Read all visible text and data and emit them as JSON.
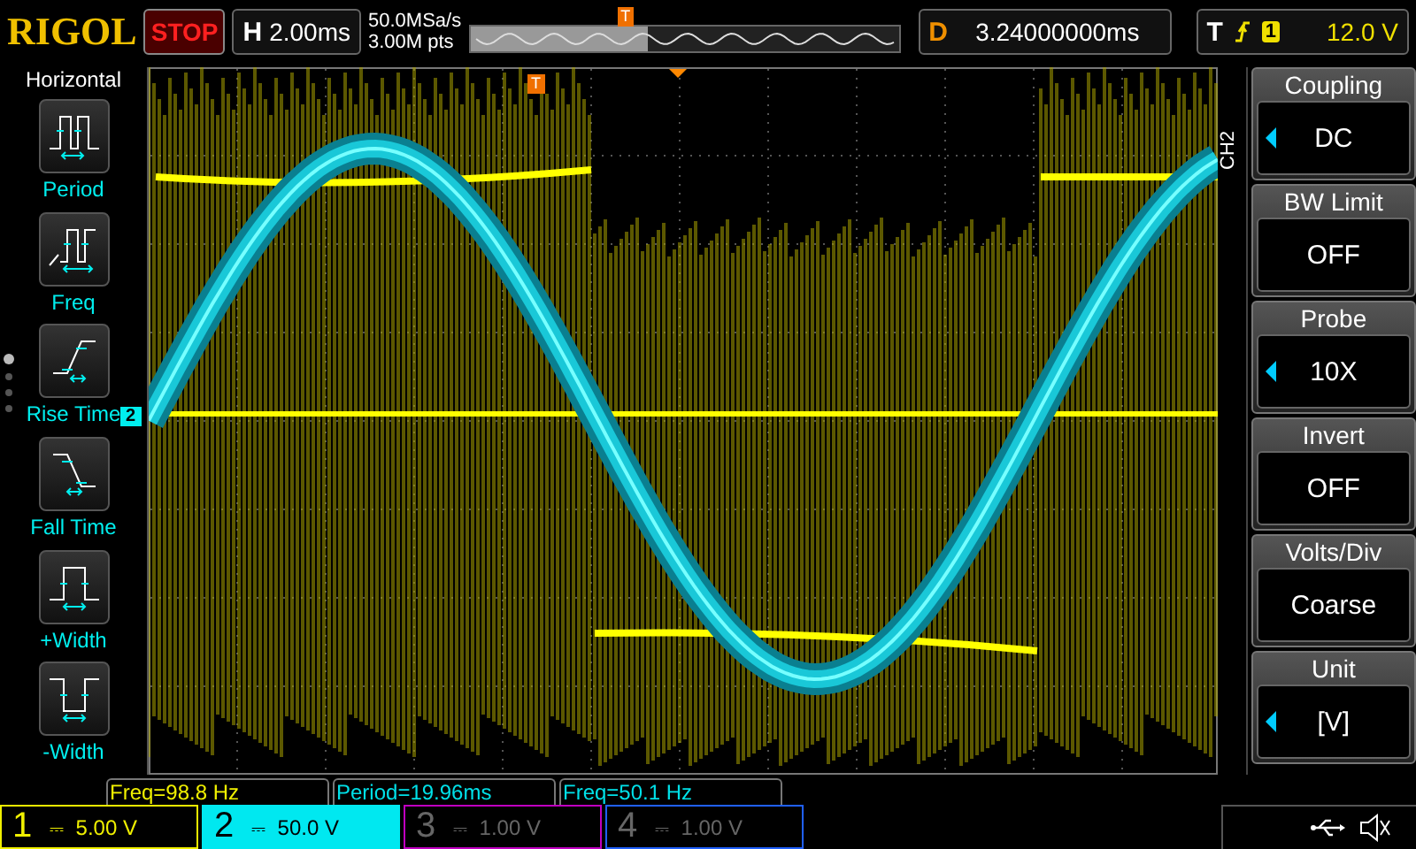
{
  "top_bar": {
    "brand": "RIGOL",
    "run_state": "STOP",
    "timebase": {
      "label": "H",
      "value": "2.00ms"
    },
    "sample_rate": "50.0MSa/s",
    "memory_depth": "3.00M pts",
    "timeline_marker": "T",
    "delay": {
      "label": "D",
      "value": "3.24000000ms"
    },
    "trigger": {
      "label": "T",
      "source": "1",
      "level": "12.0 V"
    }
  },
  "left_menu": {
    "title": "Horizontal",
    "items": [
      {
        "kind": "period",
        "label": "Period"
      },
      {
        "kind": "freq",
        "label": "Freq"
      },
      {
        "kind": "rise",
        "label": "Rise Time"
      },
      {
        "kind": "fall",
        "label": "Fall Time"
      },
      {
        "kind": "pwidth",
        "label": "+Width"
      },
      {
        "kind": "nwidth",
        "label": "-Width"
      }
    ]
  },
  "screen": {
    "trigger_marker": "T",
    "channel_marker": "2"
  },
  "right_menu": {
    "title": "CH2",
    "items": [
      {
        "label": "Coupling",
        "value": "DC",
        "adjustable": true
      },
      {
        "label": "BW Limit",
        "value": "OFF",
        "adjustable": false
      },
      {
        "label": "Probe",
        "value": "10X",
        "adjustable": true
      },
      {
        "label": "Invert",
        "value": "OFF",
        "adjustable": false
      },
      {
        "label": "Volts/Div",
        "value": "Coarse",
        "adjustable": false
      },
      {
        "label": "Unit",
        "value": "[V]",
        "adjustable": true
      }
    ]
  },
  "measurements": [
    {
      "text": "Freq=98.8 Hz",
      "color": "#f0f000"
    },
    {
      "text": "Period=19.96ms",
      "color": "#00e0e8"
    },
    {
      "text": "Freq=50.1 Hz",
      "color": "#00e0e8"
    }
  ],
  "channels": [
    {
      "number": "1",
      "coupling": "⎓",
      "scale": "5.00 V",
      "on": true,
      "selected": false,
      "color": "#f0f000"
    },
    {
      "number": "2",
      "coupling": "⎓",
      "scale": "50.0 V",
      "on": true,
      "selected": true,
      "color": "#00e8f0"
    },
    {
      "number": "3",
      "coupling": "⎓",
      "scale": "1.00 V",
      "on": false,
      "selected": false,
      "color": "#c000c0"
    },
    {
      "number": "4",
      "coupling": "⎓",
      "scale": "1.00 V",
      "on": false,
      "selected": false,
      "color": "#2060ff"
    }
  ]
}
